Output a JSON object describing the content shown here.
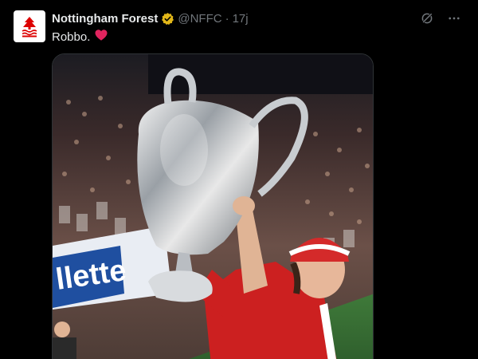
{
  "account": {
    "display_name": "Nottingham Forest",
    "handle": "@NFFC",
    "separator": "·",
    "time": "17j",
    "verified": true,
    "avatar_icon": "nottingham-forest-crest-icon"
  },
  "tweet": {
    "text": "Robbo.",
    "emoji": "red-heart-icon"
  },
  "media": {
    "description_icon": "photo",
    "banner_text": "llette"
  },
  "actions": {
    "grok_icon": "grok-icon",
    "more_icon": "more-icon"
  },
  "colors": {
    "background": "#000000",
    "text": "#e7e9ea",
    "muted": "#71767b",
    "verified_gold": "#e2b719",
    "heart": "#f91880",
    "forest_red": "#dd0000"
  }
}
